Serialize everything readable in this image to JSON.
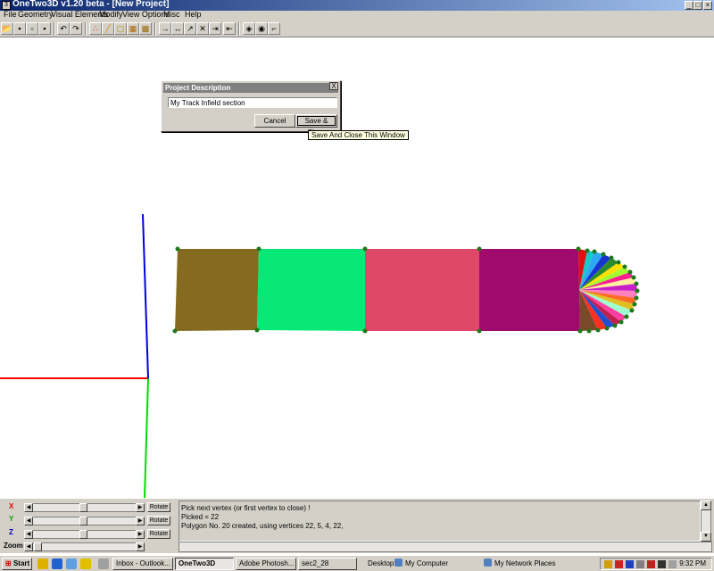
{
  "window": {
    "title": "OneTwo3D v1.20 beta - [New Project]"
  },
  "menu": [
    "File",
    "Geometry",
    "Visual Elements",
    "Modify",
    "View Options",
    "Misc",
    "Help"
  ],
  "toolbar": {
    "buttons": [
      "open-icon",
      "save-icon",
      "save-as-icon",
      "disk-icon",
      "undo-icon",
      "redo-icon",
      "vertex-icon",
      "line-icon",
      "polygon-icon",
      "texture-icon",
      "image-icon",
      "arrow-right-icon",
      "arrow-both-icon",
      "draw-icon",
      "move-icon",
      "end-arrow-icon",
      "arrow-end-icon",
      "cube-icon",
      "camera-icon",
      "scale-icon"
    ]
  },
  "dialog": {
    "title": "Project Description",
    "close_label": "X",
    "input_value": "My Track Infield section",
    "cancel_label": "Cancel",
    "save_close_label": "Save & Close"
  },
  "tooltip": {
    "text": "Save And Close This Window"
  },
  "controls": {
    "x_label": "X",
    "y_label": "Y",
    "z_label": "Z",
    "zoom_label": "Zoom",
    "rotate_label": "Rotate",
    "x_value": 0.49,
    "y_value": 0.49,
    "z_value": 0.49,
    "zoom_value": 0.0
  },
  "console": {
    "lines": [
      "Pick next vertex (or first vertex to close) !",
      "Picked = 22",
      "Polygon No. 20 created, using vertices 22, 5, 4, 22,"
    ]
  },
  "taskbar": {
    "start_label": "Start",
    "tasks": [
      "Inbox - Outlook...",
      "OneTwo3D",
      "Adobe Photosh...",
      "sec2_28"
    ],
    "desktop_label": "Desktop",
    "my_computer_label": "My Computer",
    "network_label": "My Network Places",
    "clock": "9:32 PM"
  },
  "colors": {
    "axis_x": "#ff0000",
    "axis_y": "#00dd00",
    "axis_z": "#0000dd",
    "poly1": "#856b1f",
    "poly2": "#08e876",
    "poly3": "#e0486a",
    "poly4": "#a00a6c",
    "vertex": "#1c7a18"
  }
}
